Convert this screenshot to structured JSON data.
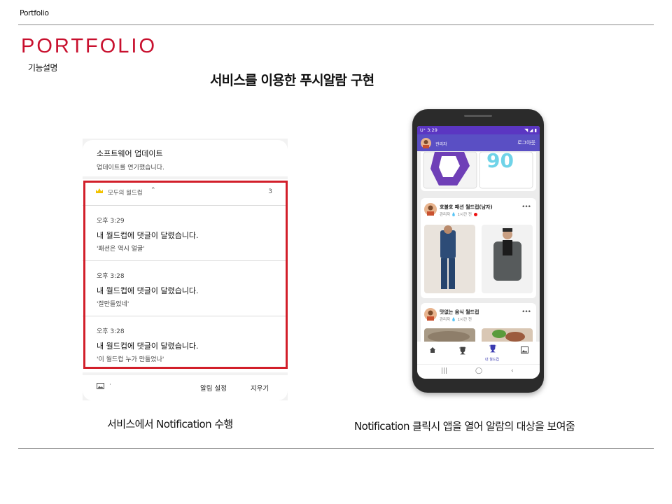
{
  "header": {
    "top_label": "Portfolio",
    "brand": "PORTFOLIO",
    "subhead": "기능설명",
    "title": "서비스를 이용한 푸시알람  구현"
  },
  "notification_panel": {
    "update_title": "소프트웨어 업데이트",
    "update_sub": "업데이트를 연기했습니다.",
    "group_title": "모두의 월드컵",
    "group_count": "3",
    "items": [
      {
        "time": "오후 3:29",
        "title": "내 월드컵에 댓글이 달렸습니다.",
        "sub": "'패션은 역시 얼굴'"
      },
      {
        "time": "오후 3:28",
        "title": "내 월드컵에 댓글이 달렸습니다.",
        "sub": "'잘만들었네'"
      },
      {
        "time": "오후 3:28",
        "title": "내 월드컵에 댓글이 달렸습니다.",
        "sub": "'이 월드컵 누가 만들었나'"
      }
    ],
    "footer_dot": "·",
    "btn_settings": "알림 설정",
    "btn_clear": "지우기"
  },
  "captions": {
    "left": "서비스에서 Notification 수행",
    "right": "Notification 클릭시 앱을 열어 알람의 대상을 보여줌"
  },
  "phone": {
    "status_time": "U⁺ 3:29",
    "status_right": "◥ ◢ ▮",
    "app_user": "관리자",
    "logout": "로그아웃",
    "cards": [
      {
        "title": "호불호 패션 월드컵(남자)",
        "meta": "관리자 💧 1시간 전"
      },
      {
        "title": "맛없는 음식 월드컵",
        "meta": "관리자 💧 1시간 전"
      }
    ],
    "nav_active_label": "내 월드컵"
  },
  "colors": {
    "brand_red": "#c8102e",
    "highlight_red": "#d21f2a",
    "status_purple": "#5b36c2",
    "appbar_purple": "#5a4fc4"
  }
}
